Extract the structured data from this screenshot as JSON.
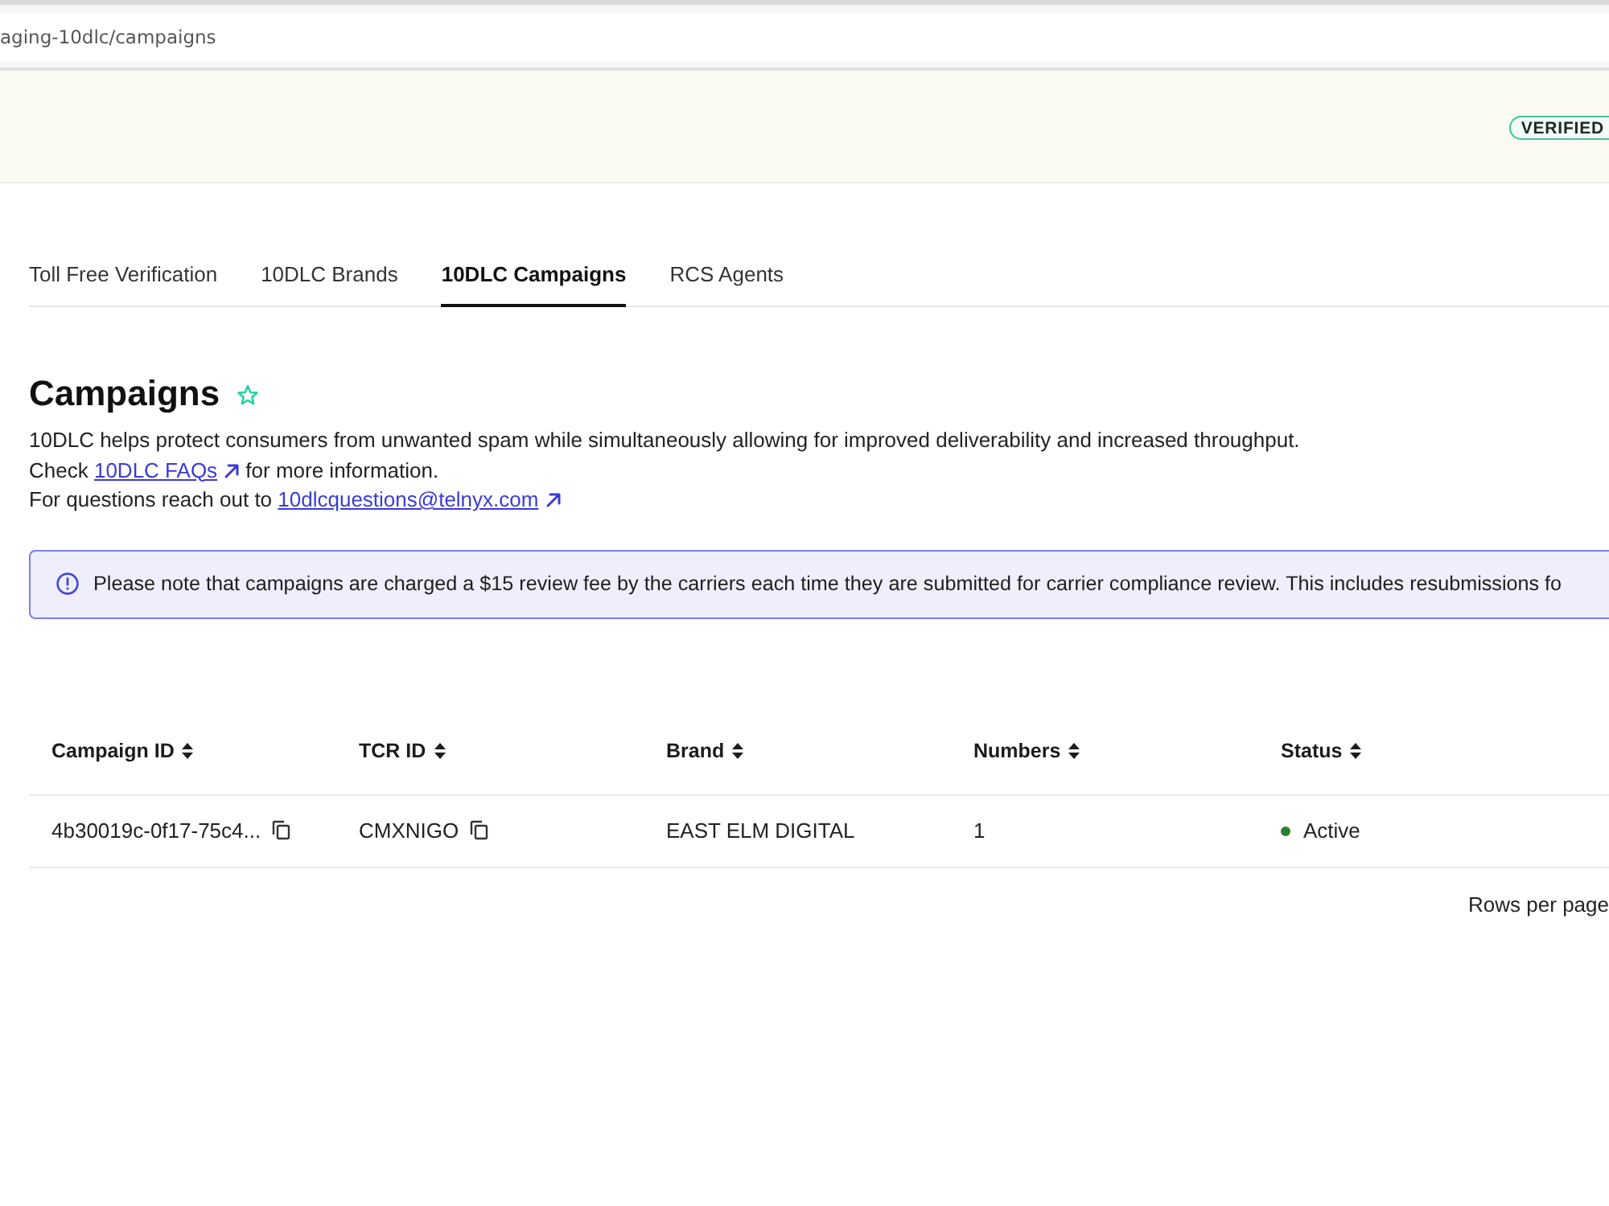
{
  "address_bar": {
    "url": "aging-10dlc/campaigns"
  },
  "banner": {
    "badge": "VERIFIED"
  },
  "tabs": [
    {
      "label": "Toll Free Verification",
      "selected": false
    },
    {
      "label": "10DLC Brands",
      "selected": false
    },
    {
      "label": "10DLC Campaigns",
      "selected": true
    },
    {
      "label": "RCS Agents",
      "selected": false
    }
  ],
  "page": {
    "title": "Campaigns",
    "starred": false
  },
  "description": {
    "intro": "10DLC helps protect consumers from unwanted spam while simultaneously allowing for improved deliverability and increased throughput.",
    "faq_note": {
      "before": "Check",
      "link": "10DLC FAQs",
      "after": "for more information."
    },
    "contact_note": {
      "before": "For questions reach out to",
      "link": "10dlcquestions@telnyx.com"
    }
  },
  "alert": {
    "text": "Please note that campaigns are charged a $15 review fee by the carriers each time they are submitted for carrier compliance review. This includes resubmissions fo"
  },
  "table": {
    "columns": [
      {
        "label": "Campaign ID"
      },
      {
        "label": "TCR ID"
      },
      {
        "label": "Brand"
      },
      {
        "label": "Numbers"
      },
      {
        "label": "Status"
      }
    ],
    "rows": [
      {
        "cells": [
          {
            "kind": "copy",
            "text": "4b30019c-0f17-75c4..."
          },
          {
            "kind": "copy",
            "text": "CMXNIGO"
          },
          {
            "kind": "text",
            "text": "EAST ELM DIGITAL"
          },
          {
            "kind": "text",
            "text": "1"
          },
          {
            "kind": "status",
            "text": "Active",
            "color": "#2e7d32"
          }
        ]
      }
    ]
  },
  "pagination": {
    "rows_per_page_label": "Rows per page"
  }
}
